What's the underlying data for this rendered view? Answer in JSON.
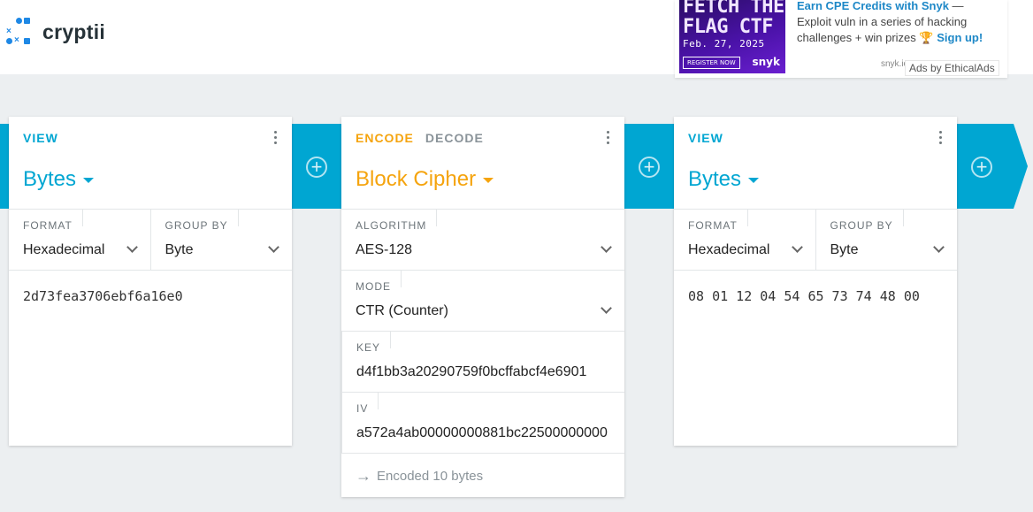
{
  "app": {
    "name": "cryptii",
    "logo_icon": "cryptii-logo-icon"
  },
  "ad": {
    "image_title": "FETCH THE FLAG CTF",
    "image_date": "Feb. 27, 2025",
    "image_button": "REGISTER NOW",
    "image_brand": "snyk",
    "headline": "Earn CPE Credits with Snyk",
    "body": " — Exploit vuln in a series of hacking challenges + win prizes",
    "trophy": "🏆",
    "cta": "Sign up!",
    "domain": "snyk.io",
    "by": "Ads by EthicalAds"
  },
  "colors": {
    "accent_blue": "#00a6d2",
    "accent_orange": "#f5a40e"
  },
  "cards": {
    "left": {
      "tab": "VIEW",
      "title": "Bytes",
      "format_label": "FORMAT",
      "format_value": "Hexadecimal",
      "group_label": "GROUP BY",
      "group_value": "Byte",
      "content": "2d73fea3706ebf6a16e0"
    },
    "middle": {
      "tab_encode": "ENCODE",
      "tab_decode": "DECODE",
      "title": "Block Cipher",
      "algorithm_label": "ALGORITHM",
      "algorithm_value": "AES-128",
      "mode_label": "MODE",
      "mode_value": "CTR (Counter)",
      "key_label": "KEY",
      "key_value": "d4f1bb3a20290759f0bcffabcf4e6901",
      "iv_label": "IV",
      "iv_value": "a572a4ab00000000881bc22500000000",
      "status_arrow": "→",
      "status": "Encoded 10 bytes"
    },
    "right": {
      "tab": "VIEW",
      "title": "Bytes",
      "format_label": "FORMAT",
      "format_value": "Hexadecimal",
      "group_label": "GROUP BY",
      "group_value": "Byte",
      "content": "08 01 12 04 54 65 73 74 48 00"
    }
  },
  "pipeline": {
    "add_symbol": "+"
  }
}
